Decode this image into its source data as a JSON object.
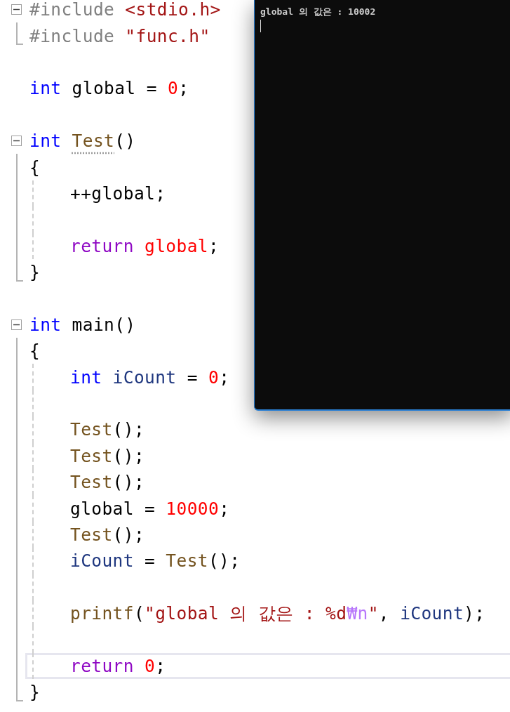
{
  "editor": {
    "lines": [
      {
        "kind": "fold",
        "tokens": [
          {
            "kind": "pp",
            "text": "#include "
          },
          {
            "kind": "str",
            "text": "<stdio.h>"
          }
        ],
        "children": [
          {
            "kind": "line",
            "tokens": [
              {
                "kind": "pp",
                "text": "#include "
              },
              {
                "kind": "str",
                "text": "\"func.h\""
              }
            ]
          }
        ]
      },
      {
        "kind": "blank"
      },
      {
        "kind": "line",
        "tokens": [
          {
            "kind": "kw",
            "text": "int "
          },
          {
            "kind": "plain",
            "text": "global = "
          },
          {
            "kind": "num",
            "text": "0"
          },
          {
            "kind": "plain",
            "text": ";"
          }
        ]
      },
      {
        "kind": "blank"
      },
      {
        "kind": "fold",
        "tokens": [
          {
            "kind": "kw",
            "text": "int "
          },
          {
            "kind": "hinted",
            "text": "Test"
          },
          {
            "kind": "plain",
            "text": "()"
          }
        ],
        "children": [
          {
            "kind": "line",
            "tokens": [
              {
                "kind": "plain",
                "text": "{"
              }
            ]
          },
          {
            "kind": "indent",
            "children": [
              {
                "kind": "line",
                "tokens": [
                  {
                    "kind": "plain",
                    "text": "++global;"
                  }
                ]
              },
              {
                "kind": "blank"
              },
              {
                "kind": "line",
                "tokens": [
                  {
                    "kind": "ctl",
                    "text": "return "
                  },
                  {
                    "kind": "num",
                    "text": "global"
                  },
                  {
                    "kind": "plain",
                    "text": ";"
                  }
                ]
              }
            ]
          },
          {
            "kind": "line",
            "tokens": [
              {
                "kind": "plain",
                "text": "}"
              }
            ]
          }
        ]
      },
      {
        "kind": "blank"
      },
      {
        "kind": "fold",
        "tokens": [
          {
            "kind": "kw",
            "text": "int "
          },
          {
            "kind": "plain",
            "text": "main()"
          }
        ],
        "children": [
          {
            "kind": "line",
            "tokens": [
              {
                "kind": "plain",
                "text": "{"
              }
            ]
          },
          {
            "kind": "indent",
            "children": [
              {
                "kind": "line",
                "tokens": [
                  {
                    "kind": "kw",
                    "text": "int "
                  },
                  {
                    "kind": "var",
                    "text": "iCount"
                  },
                  {
                    "kind": "plain",
                    "text": " = "
                  },
                  {
                    "kind": "num",
                    "text": "0"
                  },
                  {
                    "kind": "plain",
                    "text": ";"
                  }
                ]
              },
              {
                "kind": "blank"
              },
              {
                "kind": "line",
                "tokens": [
                  {
                    "kind": "fn",
                    "text": "Test"
                  },
                  {
                    "kind": "plain",
                    "text": "();"
                  }
                ]
              },
              {
                "kind": "line",
                "tokens": [
                  {
                    "kind": "fn",
                    "text": "Test"
                  },
                  {
                    "kind": "plain",
                    "text": "();"
                  }
                ]
              },
              {
                "kind": "line",
                "tokens": [
                  {
                    "kind": "fn",
                    "text": "Test"
                  },
                  {
                    "kind": "plain",
                    "text": "();"
                  }
                ]
              },
              {
                "kind": "line",
                "tokens": [
                  {
                    "kind": "plain",
                    "text": "global = "
                  },
                  {
                    "kind": "num",
                    "text": "10000"
                  },
                  {
                    "kind": "plain",
                    "text": ";"
                  }
                ]
              },
              {
                "kind": "line",
                "tokens": [
                  {
                    "kind": "fn",
                    "text": "Test"
                  },
                  {
                    "kind": "plain",
                    "text": "();"
                  }
                ]
              },
              {
                "kind": "line",
                "tokens": [
                  {
                    "kind": "var",
                    "text": "iCount"
                  },
                  {
                    "kind": "plain",
                    "text": " = "
                  },
                  {
                    "kind": "fn",
                    "text": "Test"
                  },
                  {
                    "kind": "plain",
                    "text": "();"
                  }
                ]
              },
              {
                "kind": "blank"
              },
              {
                "kind": "line",
                "tokens": [
                  {
                    "kind": "fn",
                    "text": "printf"
                  },
                  {
                    "kind": "plain",
                    "text": "("
                  },
                  {
                    "kind": "str",
                    "text": "\"global 의 값은 : %d"
                  },
                  {
                    "kind": "esc",
                    "text": "₩n"
                  },
                  {
                    "kind": "str",
                    "text": "\""
                  },
                  {
                    "kind": "plain",
                    "text": ", "
                  },
                  {
                    "kind": "var",
                    "text": "iCount"
                  },
                  {
                    "kind": "plain",
                    "text": ");"
                  }
                ]
              },
              {
                "kind": "blank"
              },
              {
                "kind": "current",
                "tokens": [
                  {
                    "kind": "ctl",
                    "text": "return "
                  },
                  {
                    "kind": "num",
                    "text": "0"
                  },
                  {
                    "kind": "plain",
                    "text": ";"
                  }
                ]
              }
            ]
          },
          {
            "kind": "line",
            "tokens": [
              {
                "kind": "plain",
                "text": "}"
              }
            ]
          }
        ]
      }
    ]
  },
  "console": {
    "output": "global 의 값은 : 10002"
  }
}
